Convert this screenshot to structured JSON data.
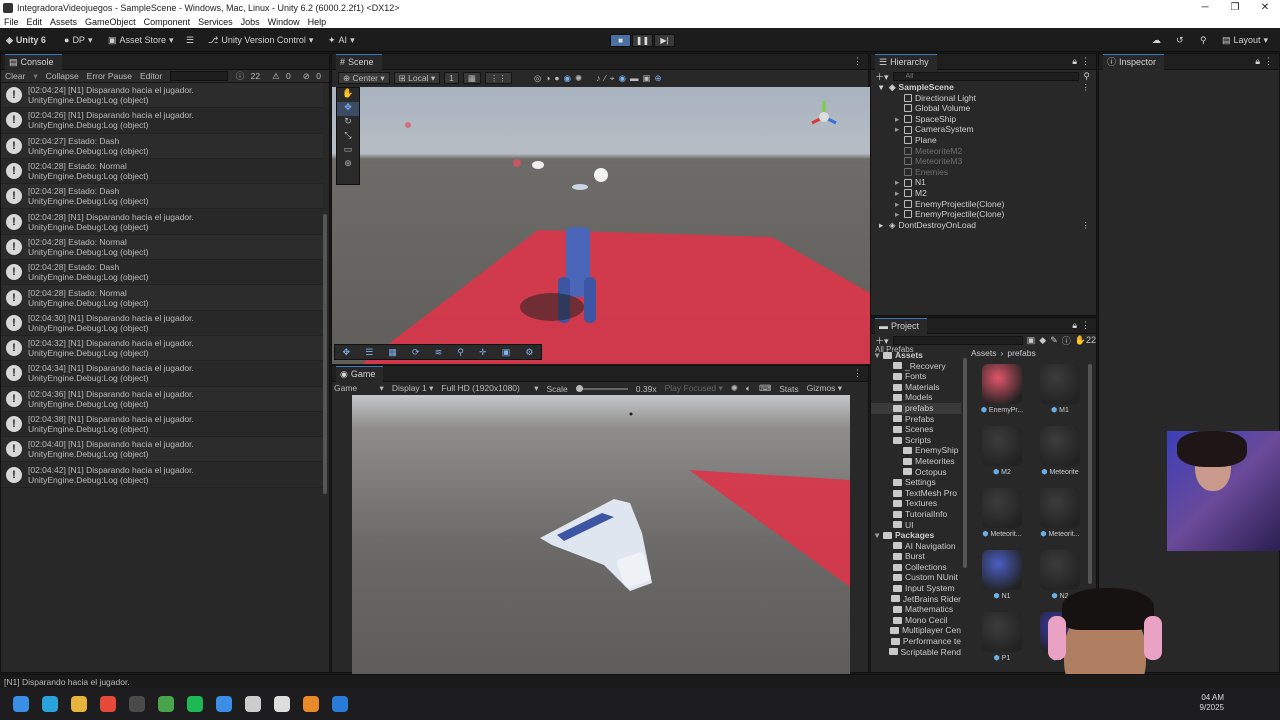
{
  "window": {
    "title": "IntegradoraVideojuegos - SampleScene - Windows, Mac, Linux - Unity 6.2 (6000.2.2f1) <DX12>"
  },
  "menu": [
    "File",
    "Edit",
    "Assets",
    "GameObject",
    "Component",
    "Services",
    "Jobs",
    "Window",
    "Help"
  ],
  "toolbar": {
    "unity": "Unity 6",
    "account": "DP",
    "asset_store": "Asset Store",
    "version_control": "Unity Version Control",
    "ai": "AI",
    "layout": "Layout"
  },
  "console": {
    "tab": "Console",
    "clear": "Clear",
    "collapse": "Collapse",
    "error_pause": "Error Pause",
    "editor": "Editor",
    "count_info": "22",
    "count_warn": "0",
    "count_err": "0",
    "logs": [
      {
        "line1": "[02:04:24] [N1] Disparando hacia el jugador.",
        "line2": "UnityEngine.Debug:Log (object)"
      },
      {
        "line1": "[02:04:26] [N1] Disparando hacia el jugador.",
        "line2": "UnityEngine.Debug:Log (object)"
      },
      {
        "line1": "[02:04:27] Estado: Dash",
        "line2": "UnityEngine.Debug:Log (object)"
      },
      {
        "line1": "[02:04:28] Estado: Normal",
        "line2": "UnityEngine.Debug:Log (object)"
      },
      {
        "line1": "[02:04:28] Estado: Dash",
        "line2": "UnityEngine.Debug:Log (object)"
      },
      {
        "line1": "[02:04:28] [N1] Disparando hacia el jugador.",
        "line2": "UnityEngine.Debug:Log (object)"
      },
      {
        "line1": "[02:04:28] Estado: Normal",
        "line2": "UnityEngine.Debug:Log (object)"
      },
      {
        "line1": "[02:04:28] Estado: Dash",
        "line2": "UnityEngine.Debug:Log (object)"
      },
      {
        "line1": "[02:04:28] Estado: Normal",
        "line2": "UnityEngine.Debug:Log (object)"
      },
      {
        "line1": "[02:04:30] [N1] Disparando hacia el jugador.",
        "line2": "UnityEngine.Debug:Log (object)"
      },
      {
        "line1": "[02:04:32] [N1] Disparando hacia el jugador.",
        "line2": "UnityEngine.Debug:Log (object)"
      },
      {
        "line1": "[02:04:34] [N1] Disparando hacia el jugador.",
        "line2": "UnityEngine.Debug:Log (object)"
      },
      {
        "line1": "[02:04:36] [N1] Disparando hacia el jugador.",
        "line2": "UnityEngine.Debug:Log (object)"
      },
      {
        "line1": "[02:04:38] [N1] Disparando hacia el jugador.",
        "line2": "UnityEngine.Debug:Log (object)"
      },
      {
        "line1": "[02:04:40] [N1] Disparando hacia el jugador.",
        "line2": "UnityEngine.Debug:Log (object)"
      },
      {
        "line1": "[02:04:42] [N1] Disparando hacia el jugador.",
        "line2": "UnityEngine.Debug:Log (object)"
      }
    ]
  },
  "scene": {
    "tab": "Scene",
    "pivot": "Center",
    "space": "Local",
    "snap": "1"
  },
  "game": {
    "tab": "Game",
    "mode": "Game",
    "display": "Display 1",
    "resolution": "Full HD (1920x1080)",
    "scale_label": "Scale",
    "scale_value": "0.39x",
    "play_focused": "Play Focused",
    "stats": "Stats",
    "gizmos": "Gizmos"
  },
  "hierarchy": {
    "tab": "Hierarchy",
    "search_placeholder": "All",
    "scene_name": "SampleScene",
    "items": [
      {
        "name": "Directional Light",
        "disabled": false,
        "expandable": false
      },
      {
        "name": "Global Volume",
        "disabled": false,
        "expandable": false
      },
      {
        "name": "SpaceShip",
        "disabled": false,
        "expandable": true
      },
      {
        "name": "CameraSystem",
        "disabled": false,
        "expandable": true
      },
      {
        "name": "Plane",
        "disabled": false,
        "expandable": false
      },
      {
        "name": "MeteoriteM2",
        "disabled": true,
        "expandable": false
      },
      {
        "name": "MeteoriteM3",
        "disabled": true,
        "expandable": false
      },
      {
        "name": "Enemies",
        "disabled": true,
        "expandable": false
      },
      {
        "name": "N1",
        "disabled": false,
        "expandable": true
      },
      {
        "name": "M2",
        "disabled": false,
        "expandable": true
      },
      {
        "name": "EnemyProjectile(Clone)",
        "disabled": false,
        "expandable": true
      },
      {
        "name": "EnemyProjectile(Clone)",
        "disabled": false,
        "expandable": true
      }
    ],
    "dont_destroy": "DontDestroyOnLoad"
  },
  "project": {
    "tab": "Project",
    "count": "22",
    "favorites": "All Prefabs",
    "breadcrumb_root": "Assets",
    "breadcrumb_leaf": "prefabs",
    "tree": [
      {
        "label": "Assets",
        "level": 0,
        "bold": true
      },
      {
        "label": "_Recovery",
        "level": 1
      },
      {
        "label": "Fonts",
        "level": 1
      },
      {
        "label": "Materials",
        "level": 1
      },
      {
        "label": "Models",
        "level": 1
      },
      {
        "label": "prefabs",
        "level": 1,
        "selected": true
      },
      {
        "label": "Prefabs",
        "level": 1
      },
      {
        "label": "Scenes",
        "level": 1
      },
      {
        "label": "Scripts",
        "level": 1
      },
      {
        "label": "EnemyShip",
        "level": 2
      },
      {
        "label": "Meteorites",
        "level": 2
      },
      {
        "label": "Octopus",
        "level": 2
      },
      {
        "label": "Settings",
        "level": 1
      },
      {
        "label": "TextMesh Pro",
        "level": 1
      },
      {
        "label": "Textures",
        "level": 1
      },
      {
        "label": "TutorialInfo",
        "level": 1
      },
      {
        "label": "UI",
        "level": 1
      },
      {
        "label": "Packages",
        "level": 0,
        "bold": true
      },
      {
        "label": "AI Navigation",
        "level": 1
      },
      {
        "label": "Burst",
        "level": 1
      },
      {
        "label": "Collections",
        "level": 1
      },
      {
        "label": "Custom NUnit",
        "level": 1
      },
      {
        "label": "Input System",
        "level": 1
      },
      {
        "label": "JetBrains Rider",
        "level": 1
      },
      {
        "label": "Mathematics",
        "level": 1
      },
      {
        "label": "Mono Cecil",
        "level": 1
      },
      {
        "label": "Multiplayer Cen",
        "level": 1
      },
      {
        "label": "Performance te",
        "level": 1
      },
      {
        "label": "Scriptable Rend",
        "level": 1
      }
    ],
    "assets": [
      {
        "label": "EnemyPr...",
        "color": "#e0566a"
      },
      {
        "label": "M1",
        "color": "#3c3c3c"
      },
      {
        "label": "M2",
        "color": "#3c3c3c"
      },
      {
        "label": "Meteorite",
        "color": "#3c3c3c"
      },
      {
        "label": "Meteorit...",
        "color": "#3c3c3c"
      },
      {
        "label": "Meteorit...",
        "color": "#3c3c3c"
      },
      {
        "label": "N1",
        "color": "#4a5fc4"
      },
      {
        "label": "N2",
        "color": "#3c3c3c"
      },
      {
        "label": "P1",
        "color": "#3c3c3c"
      },
      {
        "label": "P2",
        "color": "#3a3ab0"
      }
    ]
  },
  "inspector": {
    "tab": "Inspector"
  },
  "status": {
    "message": "[N1] Disparando hacia el jugador."
  },
  "taskbar": {
    "time": "04 AM",
    "date": "9/2025",
    "apps": [
      {
        "icon": "windows-start-icon",
        "color": "#3a8ee6"
      },
      {
        "icon": "edge-icon",
        "color": "#2aa3d8"
      },
      {
        "icon": "file-explorer-icon",
        "color": "#e6b43a"
      },
      {
        "icon": "chrome-icon",
        "color": "#e54a3a"
      },
      {
        "icon": "obs-icon",
        "color": "#4a4a4a"
      },
      {
        "icon": "chrome-icon",
        "color": "#4aa54a"
      },
      {
        "icon": "spotify-icon",
        "color": "#1db954"
      },
      {
        "icon": "chrome-icon",
        "color": "#3a8ee6"
      },
      {
        "icon": "unity-hub-icon",
        "color": "#cccccc"
      },
      {
        "icon": "unity-icon",
        "color": "#dddddd"
      },
      {
        "icon": "blender-icon",
        "color": "#e88a2a"
      },
      {
        "icon": "vscode-icon",
        "color": "#2a7ad8"
      }
    ]
  }
}
